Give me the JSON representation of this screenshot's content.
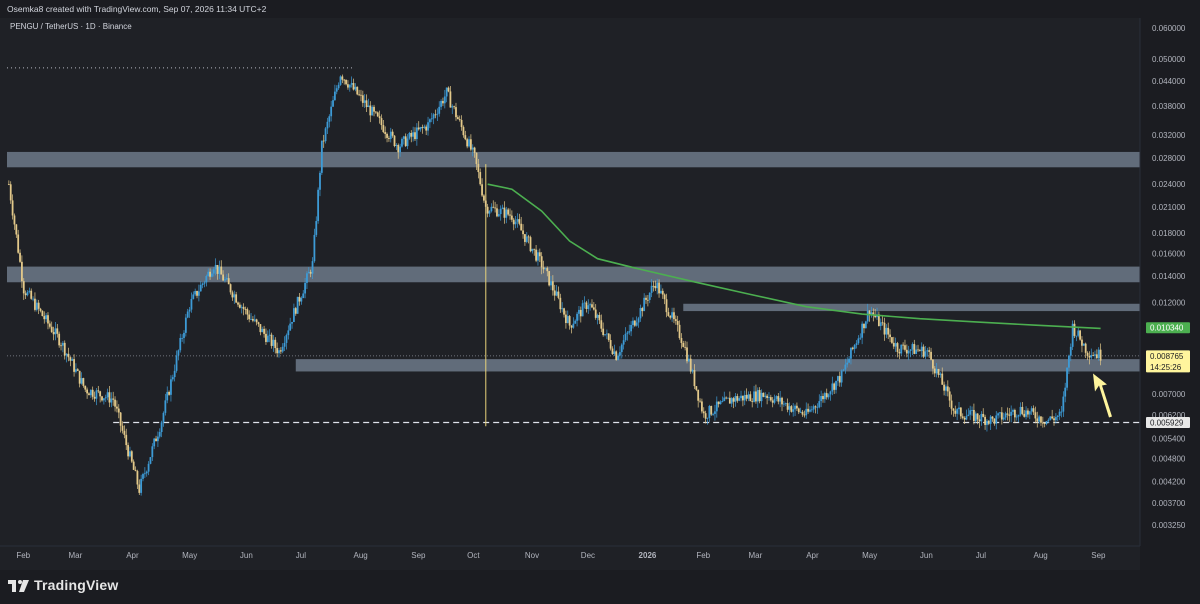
{
  "header": {
    "attribution": "Osemka8 created with TradingView.com, Sep 07, 2026 11:34 UTC+2"
  },
  "chart_data": {
    "type": "candlestick",
    "symbol": "PENGU / TetherUS · 1D · Binance",
    "scale": "log",
    "grid": false,
    "y_ticks": [
      "0.060000",
      "0.050000",
      "0.044000",
      "0.038000",
      "0.032000",
      "0.028000",
      "0.024000",
      "0.021000",
      "0.018000",
      "0.016000",
      "0.014000",
      "0.012000",
      "0.010340",
      "0.008765",
      "0.007000",
      "0.006200",
      "0.005929",
      "0.005400",
      "0.004800",
      "0.004200",
      "0.003700",
      "0.003250"
    ],
    "x_ticks": [
      "Feb",
      "Mar",
      "Apr",
      "May",
      "Jun",
      "Jul",
      "Aug",
      "Sep",
      "Oct",
      "Nov",
      "Dec",
      "2026",
      "Feb",
      "Mar",
      "Apr",
      "May",
      "Jun",
      "Jul",
      "Aug",
      "Sep"
    ],
    "last_price": {
      "value": "0.008765",
      "countdown": "14:25:26",
      "color": "#fff59d"
    },
    "moving_average": {
      "value": "0.010340",
      "color": "#4caf50"
    },
    "support_level": {
      "value": "0.005929"
    },
    "zones": [
      {
        "from": 0.0265,
        "to": 0.029
      },
      {
        "from": 0.0135,
        "to": 0.0148
      },
      {
        "from": 0.0114,
        "to": 0.0119
      },
      {
        "from": 0.008,
        "to": 0.0086
      }
    ],
    "approx_path": [
      [
        "2025-01-28",
        0.024
      ],
      [
        "2025-02-05",
        0.013
      ],
      [
        "2025-02-25",
        0.0095
      ],
      [
        "2025-03-10",
        0.0072
      ],
      [
        "2025-03-25",
        0.0068
      ],
      [
        "2025-04-08",
        0.004
      ],
      [
        "2025-04-20",
        0.006
      ],
      [
        "2025-05-05",
        0.0118
      ],
      [
        "2025-05-18",
        0.015
      ],
      [
        "2025-06-05",
        0.0112
      ],
      [
        "2025-06-22",
        0.009
      ],
      [
        "2025-07-10",
        0.015
      ],
      [
        "2025-07-15",
        0.03
      ],
      [
        "2025-07-25",
        0.046
      ],
      [
        "2025-08-10",
        0.037
      ],
      [
        "2025-08-25",
        0.03
      ],
      [
        "2025-09-10",
        0.034
      ],
      [
        "2025-09-20",
        0.041
      ],
      [
        "2025-10-05",
        0.028
      ],
      [
        "2025-10-11",
        0.021
      ],
      [
        "2025-10-25",
        0.02
      ],
      [
        "2025-11-10",
        0.015
      ],
      [
        "2025-11-25",
        0.0105
      ],
      [
        "2025-12-05",
        0.012
      ],
      [
        "2025-12-20",
        0.0088
      ],
      [
        "2026-01-10",
        0.0135
      ],
      [
        "2026-01-25",
        0.0095
      ],
      [
        "2026-02-05",
        0.0062
      ],
      [
        "2026-02-20",
        0.0068
      ],
      [
        "2026-03-10",
        0.007
      ],
      [
        "2026-04-01",
        0.0062
      ],
      [
        "2026-04-20",
        0.0078
      ],
      [
        "2026-05-05",
        0.0115
      ],
      [
        "2026-05-20",
        0.0092
      ],
      [
        "2026-06-05",
        0.009
      ],
      [
        "2026-06-20",
        0.0063
      ],
      [
        "2026-07-10",
        0.006
      ],
      [
        "2026-07-25",
        0.0064
      ],
      [
        "2026-08-08",
        0.006
      ],
      [
        "2026-08-16",
        0.0062
      ],
      [
        "2026-08-22",
        0.0104
      ],
      [
        "2026-08-30",
        0.009
      ],
      [
        "2026-09-06",
        0.0088
      ]
    ],
    "ma_path": [
      [
        "2025-10-12",
        0.024
      ],
      [
        "2025-10-25",
        0.0233
      ],
      [
        "2025-11-10",
        0.0205
      ],
      [
        "2025-11-25",
        0.0172
      ],
      [
        "2025-12-10",
        0.0155
      ],
      [
        "2026-01-01",
        0.0146
      ],
      [
        "2026-02-01",
        0.0135
      ],
      [
        "2026-03-01",
        0.0126
      ],
      [
        "2026-04-01",
        0.0117
      ],
      [
        "2026-05-01",
        0.0112
      ],
      [
        "2026-06-01",
        0.0109
      ],
      [
        "2026-07-01",
        0.0107
      ],
      [
        "2026-08-01",
        0.0105
      ],
      [
        "2026-09-06",
        0.0103
      ]
    ]
  },
  "footer": {
    "brand": "TradingView"
  }
}
